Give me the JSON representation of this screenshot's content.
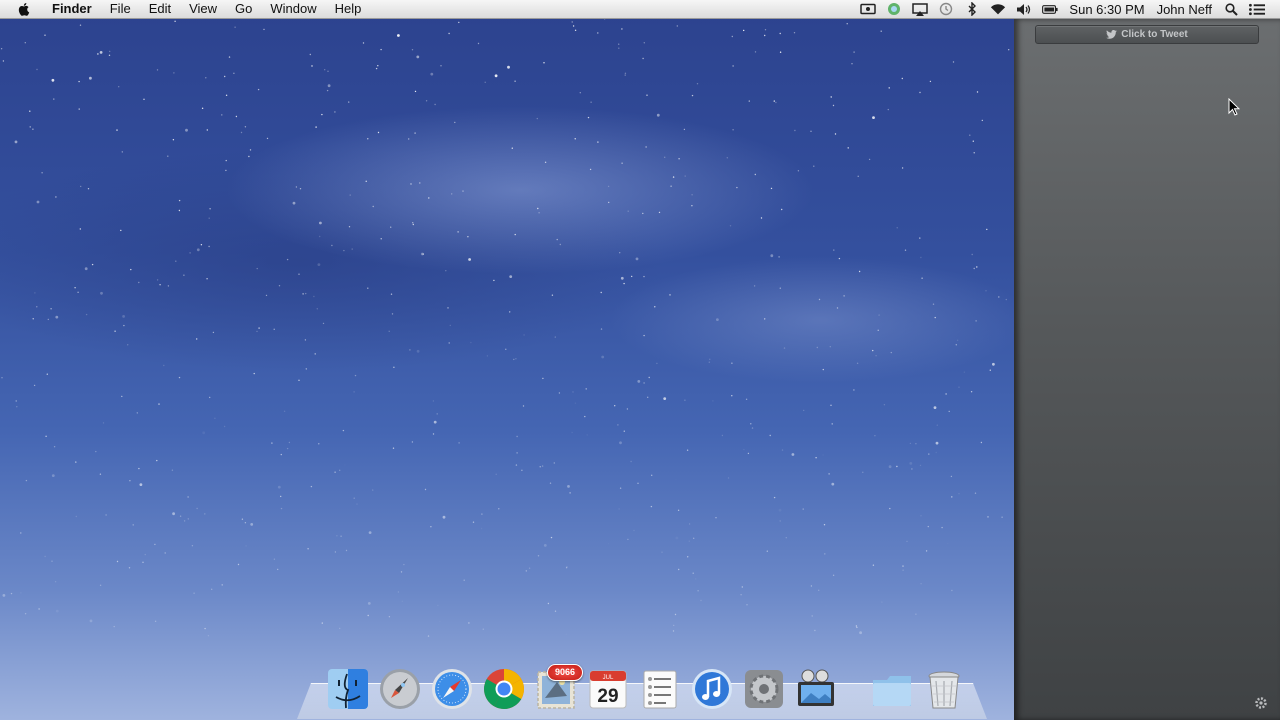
{
  "menubar": {
    "app_name": "Finder",
    "menus": [
      "File",
      "Edit",
      "View",
      "Go",
      "Window",
      "Help"
    ],
    "clock": "Sun 6:30 PM",
    "user": "John Neff"
  },
  "notification_center": {
    "tweet_label": "Click to Tweet"
  },
  "dock": {
    "mail_badge": "9066",
    "calendar_day": "29",
    "calendar_month": "JUL"
  },
  "colors": {
    "accent_blue": "#2f5fd0",
    "badge_red": "#d92a20",
    "panel_gray": "#55585a"
  }
}
